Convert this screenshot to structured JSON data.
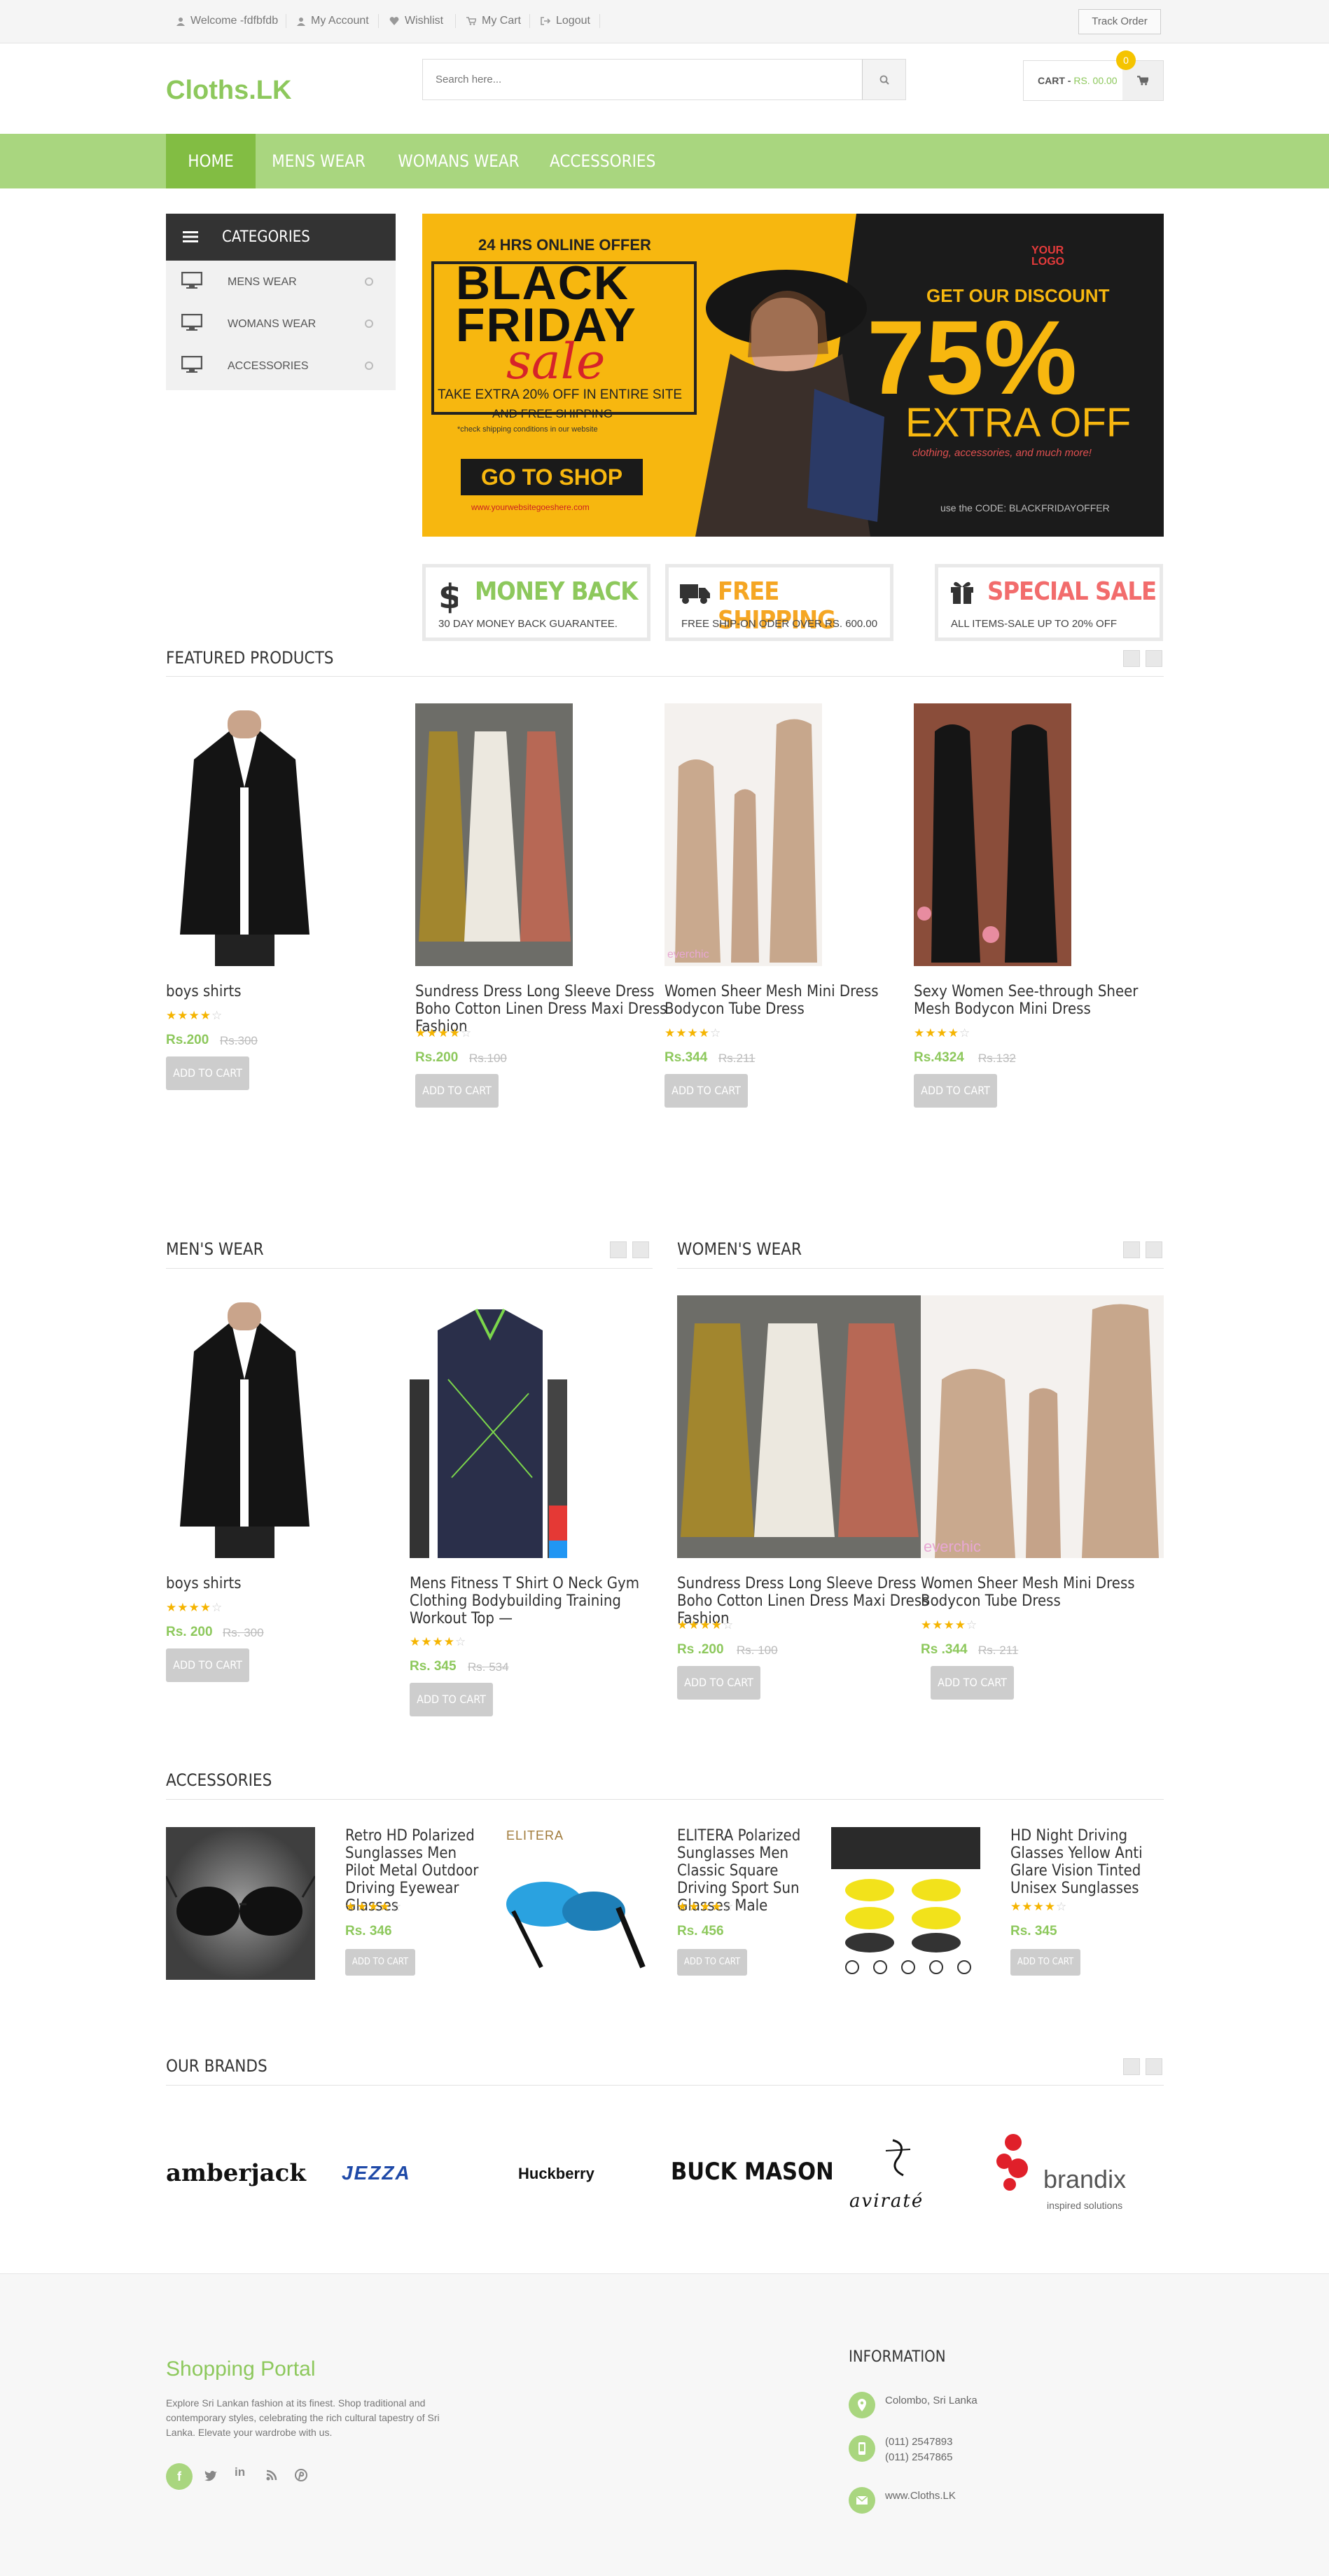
{
  "topbar": {
    "links": [
      "Welcome -fdfbfdb",
      "My Account",
      "Wishlist",
      "My Cart",
      "Logout"
    ],
    "track_order": "Track Order"
  },
  "header": {
    "logo": "Cloths.LK",
    "search_placeholder": "Search here...",
    "cart_label": "CART -",
    "cart_amount": "RS. 00.00",
    "cart_count": "0"
  },
  "nav": {
    "items": [
      "HOME",
      "MENS WEAR",
      "WOMANS WEAR",
      "ACCESSORIES"
    ]
  },
  "categories": {
    "title": "CATEGORIES",
    "items": [
      "MENS WEAR",
      "WOMANS WEAR",
      "ACCESSORIES"
    ]
  },
  "banner": {
    "top_line": "24 HRS ONLINE OFFER",
    "black": "BLACK",
    "friday": "FRIDAY",
    "sale": "sale",
    "extra_line": "TAKE EXTRA 20% OFF IN ENTIRE SITE",
    "shipping_line": "AND FREE SHIPPING",
    "note": "*check shipping conditions in our website",
    "go_shop": "GO TO SHOP",
    "site": "www.yourwebsitegoeshere.com",
    "your_logo": "YOUR LOGO",
    "get_discount": "GET OUR DISCOUNT",
    "percent": "75%",
    "extra_off": "EXTRA OFF",
    "items_line": "clothing, accessories, and much more!",
    "code": "use the CODE: BLACKFRIDAYOFFER"
  },
  "features": [
    {
      "title": "MONEY BACK",
      "sub": "30 DAY MONEY BACK GUARANTEE.",
      "color": "#8dc85c"
    },
    {
      "title": "FREE SHIPPING",
      "sub": "FREE SHIP-ON ODER OVER RS. 600.00",
      "color": "#f5a623"
    },
    {
      "title": "SPECIAL SALE",
      "sub": "ALL ITEMS-SALE UP TO 20% OFF",
      "color": "#f26c6c"
    }
  ],
  "featured": {
    "title": "FEATURED PRODUCTS",
    "products": [
      {
        "name": "boys shirts",
        "price": "Rs.200",
        "old": "Rs.300",
        "rating": 4,
        "button": "ADD TO CART"
      },
      {
        "name": "Sundress Dress Long Sleeve Dress Boho Cotton Linen Dress Maxi Dress Fashion",
        "price": "Rs.200",
        "old": "Rs.100",
        "rating": 4,
        "button": "ADD TO CART"
      },
      {
        "name": "Women Sheer Mesh Mini Dress Bodycon Tube Dress",
        "price": "Rs.344",
        "old": "Rs.211",
        "rating": 4,
        "button": "ADD TO CART"
      },
      {
        "name": "Sexy Women See-through Sheer Mesh Bodycon Mini Dress",
        "price": "Rs.4324",
        "old": "Rs.132",
        "rating": 4,
        "button": "ADD TO CART"
      }
    ]
  },
  "mens": {
    "title": "MEN'S WEAR",
    "products": [
      {
        "name": "boys shirts",
        "price": "Rs. 200",
        "old": "Rs. 300",
        "rating": 4,
        "button": "ADD TO CART"
      },
      {
        "name": "Mens Fitness T Shirt O Neck Gym Clothing Bodybuilding Training Workout Top —",
        "price": "Rs. 345",
        "old": "Rs. 534",
        "rating": 4,
        "button": "ADD TO CART"
      }
    ]
  },
  "womens": {
    "title": "WOMEN'S WEAR",
    "products": [
      {
        "name": "Sundress Dress Long Sleeve Dress Boho Cotton Linen Dress Maxi Dress Fashion",
        "price": "Rs .200",
        "old": "Rs. 100",
        "rating": 4,
        "button": "ADD TO CART"
      },
      {
        "name": "Women Sheer Mesh Mini Dress Bodycon Tube Dress",
        "price": "Rs .344",
        "old": "Rs. 211",
        "rating": 4,
        "button": "ADD TO CART"
      }
    ]
  },
  "accessories": {
    "title": "ACCESSORIES",
    "products": [
      {
        "name": "Retro HD Polarized Sunglasses Men Pilot Metal Outdoor Driving Eyewear Glasses",
        "price": "Rs. 346",
        "rating": 4,
        "button": "ADD TO CART"
      },
      {
        "name": "ELITERA Polarized Sunglasses Men Classic Square Driving Sport Sun Glasses Male",
        "price": "Rs. 456",
        "rating": 4,
        "button": "ADD TO CART",
        "image_text": "ELITERA"
      },
      {
        "name": "HD Night Driving Glasses Yellow Anti Glare Vision Tinted Unisex Sunglasses",
        "price": "Rs. 345",
        "rating": 4,
        "button": "ADD TO CART"
      }
    ]
  },
  "brands": {
    "title": "OUR BRANDS",
    "items": [
      "amberjack",
      "JEZZA",
      "Huckberry",
      "BUCK MASON",
      "aviraté",
      "brandix",
      "inspired solutions"
    ]
  },
  "watermark": "everchic",
  "footer": {
    "title": "Shopping Portal",
    "about": "Explore Sri Lankan fashion at its finest. Shop traditional and contemporary styles, celebrating the rich cultural tapestry of Sri Lanka. Elevate your wardrobe with us.",
    "info_title": "INFORMATION",
    "address": "Colombo, Sri Lanka",
    "phone1": "(011) 2547893",
    "phone2": "(011) 2547865",
    "web": "www.Cloths.LK"
  }
}
